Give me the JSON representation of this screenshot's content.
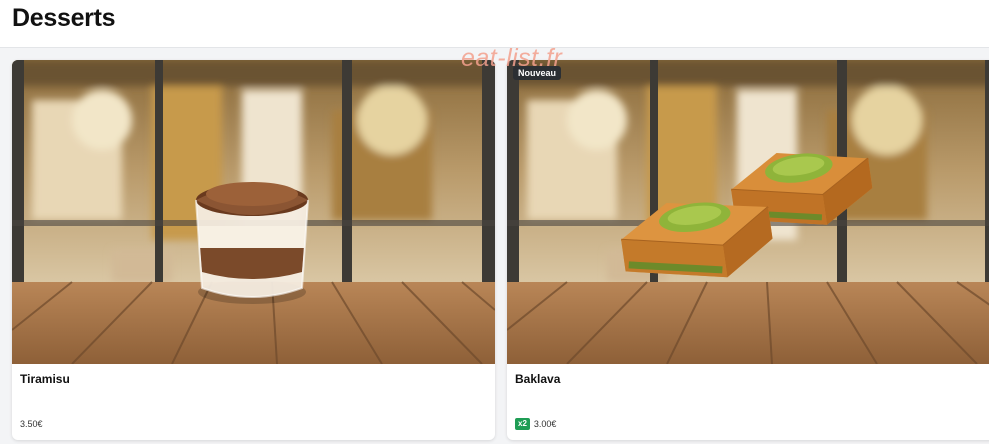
{
  "header": {
    "title": "Desserts"
  },
  "watermark": "eat-list.fr",
  "colors": {
    "accent_green": "#1f9d55",
    "badge_dark": "#2b2f33"
  },
  "items": [
    {
      "name": "Tiramisu",
      "price": "3.50€",
      "image": "tiramisu-cup-on-wooden-table"
    },
    {
      "name": "Baklava",
      "price": "3.00€",
      "badge": "Nouveau",
      "quantity_badge": "x2",
      "image": "two-baklava-pieces-on-wooden-table"
    }
  ]
}
